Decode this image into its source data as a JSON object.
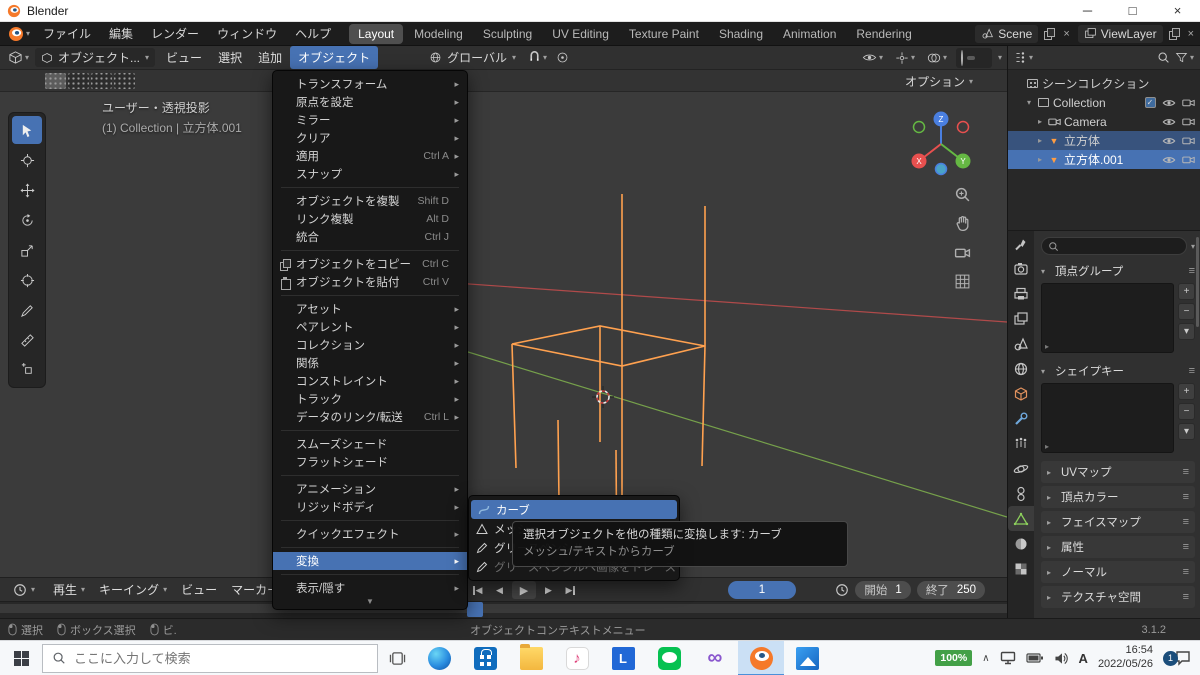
{
  "colors": {
    "accent": "#4772b3",
    "selection_orange": "#ff9d43"
  },
  "titlebar": {
    "title": "Blender"
  },
  "menubar": {
    "menus": [
      "ファイル",
      "編集",
      "レンダー",
      "ウィンドウ",
      "ヘルプ"
    ],
    "workspaces": [
      "Layout",
      "Modeling",
      "Sculpting",
      "UV Editing",
      "Texture Paint",
      "Shading",
      "Animation",
      "Rendering"
    ],
    "active_workspace": "Layout",
    "scene": "Scene",
    "viewlayer": "ViewLayer"
  },
  "viewport_header": {
    "mode": "オブジェクト...",
    "menus": [
      "ビュー",
      "選択",
      "追加",
      "オブジェクト"
    ],
    "active_menu": "オブジェクト",
    "orientation": "グローバル"
  },
  "tool_header": {
    "options": "オプション"
  },
  "viewport": {
    "view_label": "ユーザー・透視投影",
    "context_label": "(1) Collection | 立方体.001",
    "axis": {
      "x": "X",
      "y": "Y",
      "z": "Z"
    }
  },
  "object_menu": {
    "items": [
      {
        "label": "トランスフォーム",
        "submenu": true
      },
      {
        "label": "原点を設定",
        "submenu": true
      },
      {
        "label": "ミラー",
        "submenu": true
      },
      {
        "label": "クリア",
        "submenu": true
      },
      {
        "label": "適用",
        "shortcut": "Ctrl A",
        "submenu": true
      },
      {
        "label": "スナップ",
        "submenu": true
      },
      {
        "sep": true
      },
      {
        "label": "オブジェクトを複製",
        "shortcut": "Shift D"
      },
      {
        "label": "リンク複製",
        "shortcut": "Alt D"
      },
      {
        "label": "統合",
        "shortcut": "Ctrl J"
      },
      {
        "sep": true
      },
      {
        "label": "オブジェクトをコピー",
        "shortcut": "Ctrl C",
        "icon": "copy"
      },
      {
        "label": "オブジェクトを貼付",
        "shortcut": "Ctrl V",
        "icon": "paste"
      },
      {
        "sep": true
      },
      {
        "label": "アセット",
        "submenu": true
      },
      {
        "label": "ペアレント",
        "submenu": true
      },
      {
        "label": "コレクション",
        "submenu": true
      },
      {
        "label": "関係",
        "submenu": true
      },
      {
        "label": "コンストレイント",
        "submenu": true
      },
      {
        "label": "トラック",
        "submenu": true
      },
      {
        "label": "データのリンク/転送",
        "shortcut": "Ctrl L",
        "submenu": true
      },
      {
        "sep": true
      },
      {
        "label": "スムーズシェード"
      },
      {
        "label": "フラットシェード"
      },
      {
        "sep": true
      },
      {
        "label": "アニメーション",
        "submenu": true
      },
      {
        "label": "リジッドボディ",
        "submenu": true
      },
      {
        "sep": true
      },
      {
        "label": "クイックエフェクト",
        "submenu": true
      },
      {
        "sep": true
      },
      {
        "label": "変換",
        "submenu": true,
        "highlighted": true
      },
      {
        "sep": true
      },
      {
        "label": "表示/隠す",
        "submenu": true
      }
    ]
  },
  "convert_submenu": {
    "items": [
      {
        "label": "カーブ",
        "icon": "curve",
        "highlighted": true
      },
      {
        "label": "メッシュ",
        "icon": "mesh"
      },
      {
        "label": "グリースペンシル",
        "icon": "gpencil"
      },
      {
        "label": "グリースペンシルへ画像をトレース",
        "icon": "gpencil",
        "disabled": true
      }
    ]
  },
  "tooltip": {
    "line1": "選択オブジェクトを他の種類に変換します: カーブ",
    "line2": "メッシュ/テキストからカーブ"
  },
  "outliner": {
    "rows": [
      {
        "label": "シーンコレクション",
        "icon": "scene-collection",
        "indent": 0,
        "caret": "none",
        "toggles": []
      },
      {
        "label": "Collection",
        "icon": "collection",
        "indent": 1,
        "caret": "open",
        "toggles": [
          "checkbox",
          "eye",
          "camera"
        ]
      },
      {
        "label": "Camera",
        "icon": "camera",
        "indent": 2,
        "caret": "closed",
        "toggles": [
          "eye",
          "camera"
        ]
      },
      {
        "label": "立方体",
        "icon": "mesh",
        "indent": 2,
        "caret": "closed",
        "selected": true,
        "toggles": [
          "eye",
          "camera"
        ]
      },
      {
        "label": "立方体.001",
        "icon": "mesh",
        "indent": 2,
        "caret": "closed",
        "active": true,
        "toggles": [
          "eye",
          "camera"
        ]
      }
    ]
  },
  "properties": {
    "tabs": [
      "tool",
      "render",
      "output",
      "view-layer",
      "scene",
      "world",
      "object",
      "modifiers",
      "particles",
      "physics",
      "constraints",
      "data",
      "material",
      "texture"
    ],
    "active_tab": "data",
    "sections": [
      {
        "title": "頂点グループ",
        "type": "list"
      },
      {
        "title": "シェイプキー",
        "type": "list"
      },
      {
        "title": "UVマップ",
        "type": "collapsed"
      },
      {
        "title": "頂点カラー",
        "type": "collapsed"
      },
      {
        "title": "フェイスマップ",
        "type": "collapsed"
      },
      {
        "title": "属性",
        "type": "collapsed"
      },
      {
        "title": "ノーマル",
        "type": "collapsed"
      },
      {
        "title": "テクスチャ空間",
        "type": "collapsed"
      }
    ]
  },
  "timeline": {
    "menus": [
      {
        "label": "再生",
        "caret": true
      },
      {
        "label": "キーイング",
        "caret": true
      },
      {
        "label": "ビュー",
        "caret": false
      },
      {
        "label": "マーカー",
        "caret": false
      }
    ],
    "current_frame": "1",
    "start_label": "開始",
    "start_value": "1",
    "end_label": "終了",
    "end_value": "250"
  },
  "statusbar": {
    "hints": [
      "選択",
      "ボックス選択",
      "ビ."
    ],
    "context": "オブジェクトコンテキストメニュー",
    "version": "3.1.2"
  },
  "taskbar": {
    "search_placeholder": "ここに入力して検索",
    "apps": [
      "edge",
      "store",
      "folder",
      "music",
      "ltile",
      "line",
      "vs",
      "blender",
      "photos"
    ],
    "active_app": "blender",
    "battery": "100%",
    "ime": "A",
    "time": "16:54",
    "date": "2022/05/26",
    "badge": "1"
  }
}
